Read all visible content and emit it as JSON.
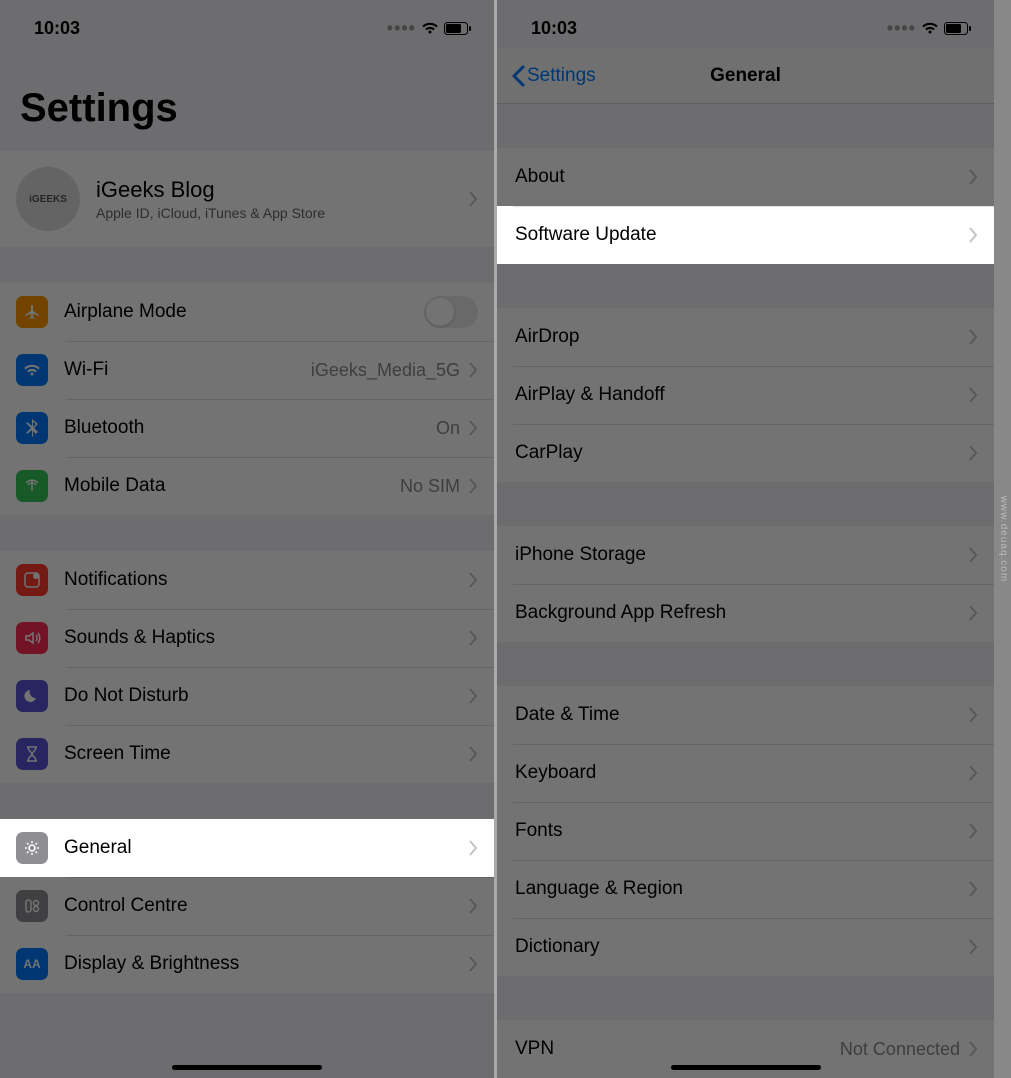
{
  "status": {
    "time": "10:03"
  },
  "left": {
    "title": "Settings",
    "profile": {
      "avatarText": "iGEEKS",
      "name": "iGeeks Blog",
      "subtitle": "Apple ID, iCloud, iTunes & App Store"
    },
    "rows1": {
      "airplane": "Airplane Mode",
      "wifi": "Wi-Fi",
      "wifiValue": "iGeeks_Media_5G",
      "bluetooth": "Bluetooth",
      "bluetoothValue": "On",
      "mobile": "Mobile Data",
      "mobileValue": "No SIM"
    },
    "rows2": {
      "notifications": "Notifications",
      "sounds": "Sounds & Haptics",
      "dnd": "Do Not Disturb",
      "screentime": "Screen Time"
    },
    "rows3": {
      "general": "General",
      "control": "Control Centre",
      "display": "Display & Brightness"
    }
  },
  "right": {
    "back": "Settings",
    "title": "General",
    "g1": {
      "about": "About",
      "software": "Software Update"
    },
    "g2": {
      "airdrop": "AirDrop",
      "airplay": "AirPlay & Handoff",
      "carplay": "CarPlay"
    },
    "g3": {
      "storage": "iPhone Storage",
      "bgrefresh": "Background App Refresh"
    },
    "g4": {
      "date": "Date & Time",
      "keyboard": "Keyboard",
      "fonts": "Fonts",
      "lang": "Language & Region",
      "dict": "Dictionary"
    },
    "g5": {
      "vpn": "VPN",
      "vpnValue": "Not Connected"
    }
  },
  "watermark": "www.deuaq.com"
}
